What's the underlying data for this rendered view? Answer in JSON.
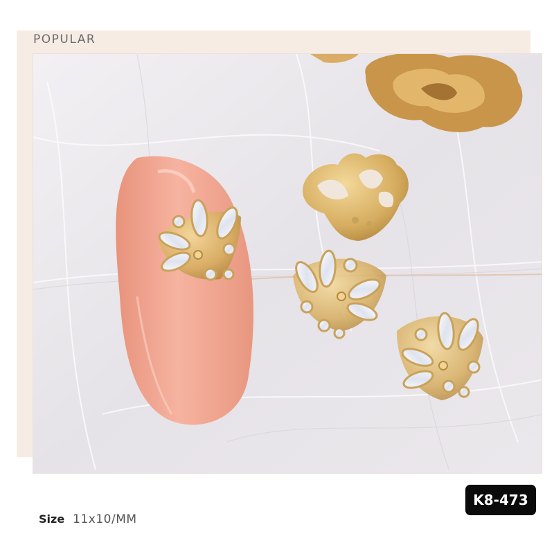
{
  "header": {
    "title": "POPULAR"
  },
  "photo": {
    "subject": "nail-charm-photo",
    "colors": {
      "feather_bg": "#ece9ec",
      "nail_pink": "#f2a893",
      "gold": "#d8b26a",
      "gold_dark": "#b88a3e",
      "rose_gold": "#c99a55",
      "crystal": "#f4f6fb"
    }
  },
  "spec": {
    "size_label": "Size",
    "size_value": "11x10/MM"
  },
  "product": {
    "code": "K8-473"
  },
  "colors": {
    "frame": "#f7ece4",
    "badge_bg": "#0b0b0b",
    "badge_text": "#ffffff"
  }
}
